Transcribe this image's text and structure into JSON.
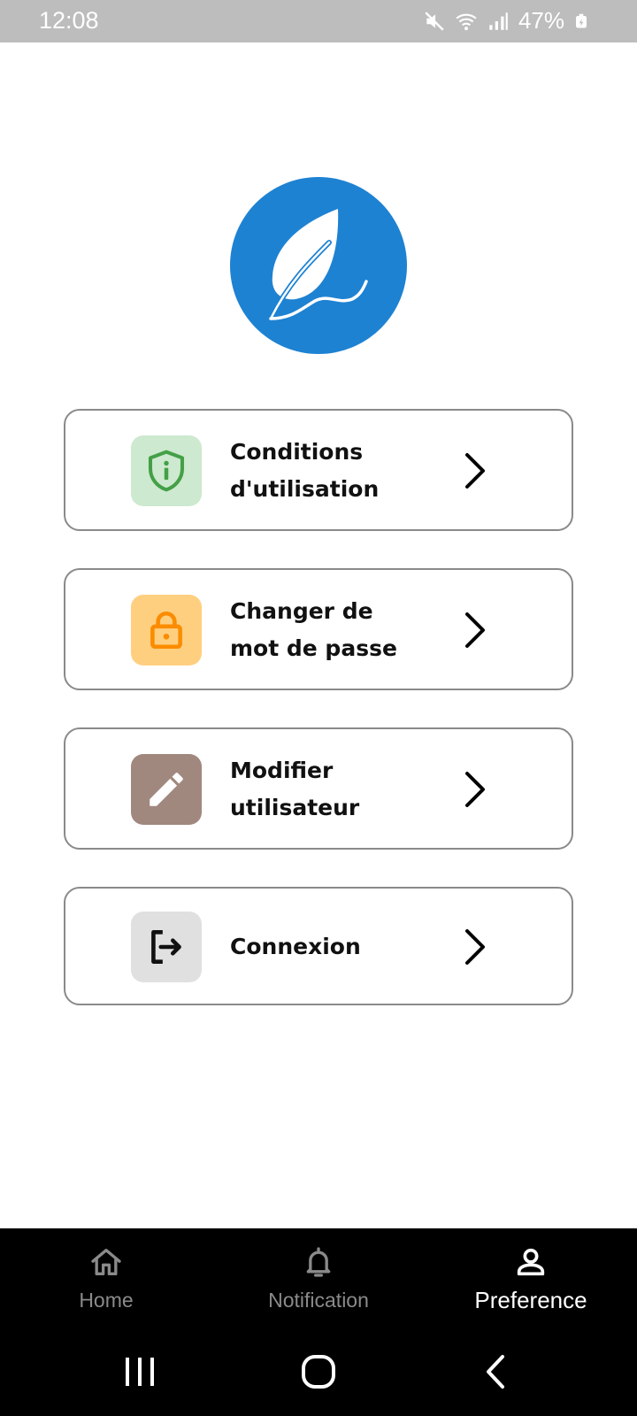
{
  "status_bar": {
    "time": "12:08",
    "battery": "47%",
    "icons": [
      "mute-icon",
      "wifi-icon",
      "signal-icon",
      "battery-icon"
    ]
  },
  "logo": {
    "icon": "leaf-icon",
    "color": "#1e82d2"
  },
  "menu": [
    {
      "label": "Conditions\nd'utilisation",
      "icon": "shield-info-icon",
      "icon_bg": "#cde9cf",
      "icon_color": "#43a047"
    },
    {
      "label": "Changer de\nmot de passe",
      "icon": "lock-icon",
      "icon_bg": "#ffcf80",
      "icon_color": "#fb8c00"
    },
    {
      "label": "Modifier\nutilisateur",
      "icon": "edit-icon",
      "icon_bg": "#a1887f",
      "icon_color": "#ffffff"
    },
    {
      "label": "Connexion",
      "icon": "logout-icon",
      "icon_bg": "#e0e0e0",
      "icon_color": "#111111"
    }
  ],
  "bottom_nav": [
    {
      "label": "Home",
      "icon": "home-icon",
      "active": false
    },
    {
      "label": "Notification",
      "icon": "bell-icon",
      "active": false
    },
    {
      "label": "Preference",
      "icon": "person-icon",
      "active": true
    }
  ],
  "system_nav": [
    "recents-button",
    "home-button",
    "back-button"
  ]
}
